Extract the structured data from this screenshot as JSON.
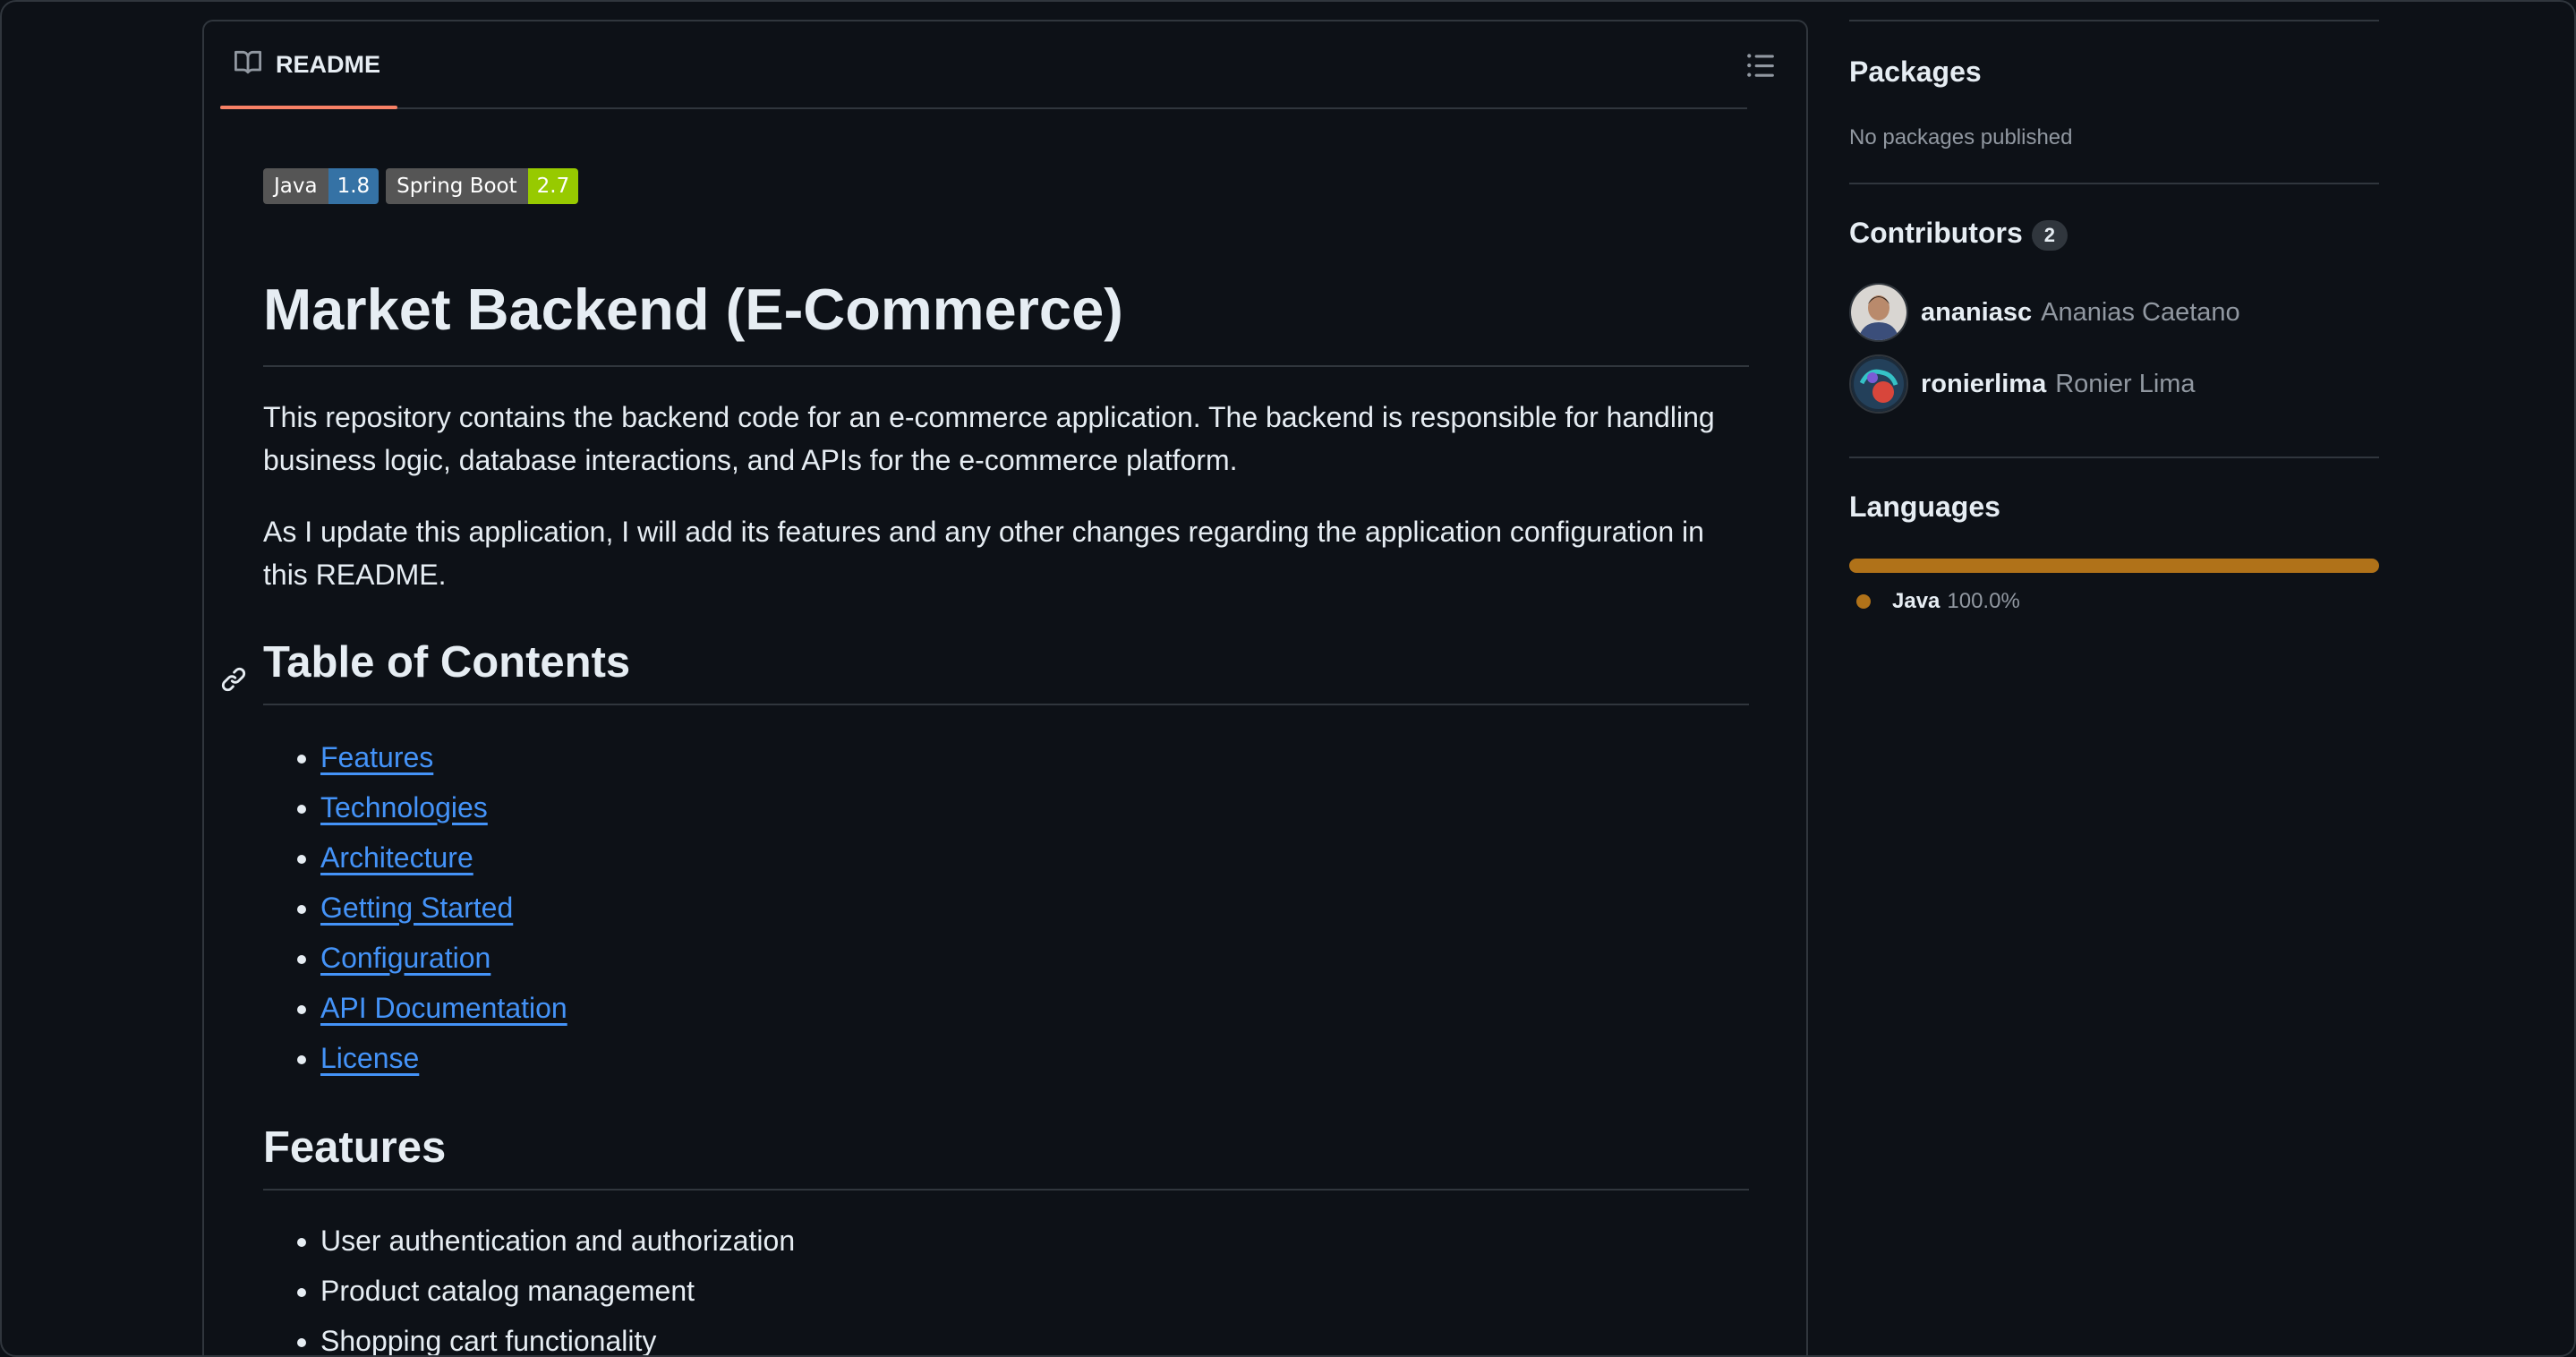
{
  "readme": {
    "tab_label": "README",
    "badges": [
      {
        "key": "Java",
        "value": "1.8",
        "color": "#3572A5"
      },
      {
        "key": "Spring Boot",
        "value": "2.7",
        "color": "#97ca00"
      }
    ],
    "title": "Market Backend (E-Commerce)",
    "intro_1": "This repository contains the backend code for an e-commerce application. The backend is responsible for handling business logic, database interactions, and APIs for the e-commerce platform.",
    "intro_2": "As I update this application, I will add its features and any other changes regarding the application configuration in this README.",
    "toc_heading": "Table of Contents",
    "toc_links": [
      "Features",
      "Technologies",
      "Architecture",
      "Getting Started",
      "Configuration",
      "API Documentation",
      "License"
    ],
    "features_heading": "Features",
    "features": [
      "User authentication and authorization",
      "Product catalog management",
      "Shopping cart functionality"
    ]
  },
  "sidebar": {
    "packages_heading": "Packages",
    "packages_text": "No packages published",
    "contributors_heading": "Contributors",
    "contributors_count": "2",
    "contributors": [
      {
        "login": "ananiasc",
        "name": "Ananias Caetano"
      },
      {
        "login": "ronierlima",
        "name": "Ronier Lima"
      }
    ],
    "languages_heading": "Languages",
    "languages": [
      {
        "name": "Java",
        "percent": "100.0%",
        "color": "#b07219"
      }
    ]
  },
  "colors": {
    "accent_underline": "#f78166",
    "link": "#4493f8",
    "background": "#0d1117"
  }
}
